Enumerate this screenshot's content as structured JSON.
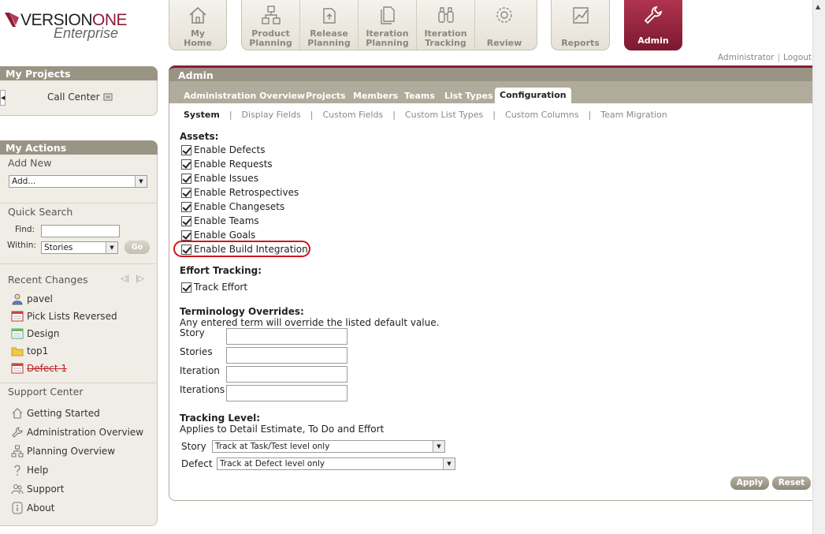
{
  "brand": {
    "word1_a": "VERSION",
    "word1_b": "ONE",
    "word2": "Enterprise"
  },
  "nav_left": [
    {
      "l1": "My",
      "l2": "Home",
      "icon": "home-icon"
    }
  ],
  "nav_mid": [
    {
      "l1": "Product",
      "l2": "Planning",
      "icon": "hierarchy-icon"
    },
    {
      "l1": "Release",
      "l2": "Planning",
      "icon": "release-icon"
    },
    {
      "l1": "Iteration",
      "l2": "Planning",
      "icon": "iteration-icon"
    },
    {
      "l1": "Iteration",
      "l2": "Tracking",
      "icon": "binoculars-icon"
    },
    {
      "l1": "",
      "l2": "Review",
      "icon": "gear-icon"
    }
  ],
  "nav_reports": {
    "label": "Reports",
    "icon": "chart-icon"
  },
  "nav_admin": {
    "label": "Admin",
    "icon": "wrench-icon"
  },
  "user_links": {
    "user": "Administrator",
    "sep": "|",
    "logout": "Logout"
  },
  "my_projects": {
    "title": "My Projects",
    "project": "Call Center"
  },
  "my_actions": {
    "title": "My Actions",
    "add_new": "Add New",
    "add_select": "Add...",
    "quick_search": "Quick Search",
    "find_label": "Find:",
    "within_label": "Within:",
    "within_value": "Stories",
    "go": "Go"
  },
  "recent": {
    "title": "Recent Changes",
    "items": [
      {
        "label": "pavel",
        "icon": "user-icon"
      },
      {
        "label": "Pick Lists Reversed",
        "icon": "defect-icon"
      },
      {
        "label": "Design",
        "icon": "story-icon"
      },
      {
        "label": "top1",
        "icon": "folder-icon"
      },
      {
        "label": "Defect 1",
        "icon": "defect-icon",
        "struck": true
      }
    ]
  },
  "support": {
    "title": "Support Center",
    "items": [
      {
        "label": "Getting Started",
        "icon": "home-icon"
      },
      {
        "label": "Administration Overview",
        "icon": "wrench-icon"
      },
      {
        "label": "Planning Overview",
        "icon": "hierarchy-icon"
      },
      {
        "label": "Help",
        "icon": "question-icon"
      },
      {
        "label": "Support",
        "icon": "people-icon"
      },
      {
        "label": "About",
        "icon": "info-icon"
      }
    ]
  },
  "main": {
    "title": "Admin",
    "tabs": [
      "Administration Overview",
      "Projects",
      "Members",
      "Teams",
      "List Types",
      "Configuration"
    ],
    "active_tab": "Configuration",
    "subtabs": [
      "System",
      "Display Fields",
      "Custom Fields",
      "Custom List Types",
      "Custom Columns",
      "Team Migration"
    ],
    "assets_title": "Assets:",
    "assets": [
      "Enable Defects",
      "Enable Requests",
      "Enable Issues",
      "Enable Retrospectives",
      "Enable Changesets",
      "Enable Teams",
      "Enable Goals",
      "Enable Build Integration"
    ],
    "effort_title": "Effort Tracking:",
    "effort": [
      "Track Effort"
    ],
    "term_title": "Terminology Overrides:",
    "term_desc": "Any entered term will override the listed default value.",
    "terms": [
      "Story",
      "Stories",
      "Iteration",
      "Iterations"
    ],
    "tracking_title": "Tracking Level:",
    "tracking_desc": "Applies to Detail Estimate, To Do and Effort",
    "tracking": [
      {
        "label": "Story",
        "value": "Track at Task/Test level only"
      },
      {
        "label": "Defect",
        "value": "Track at Defect level only"
      }
    ],
    "apply": "Apply",
    "reset": "Reset"
  },
  "colors": {
    "accent": "#8a1c3a",
    "panel": "#9a9484",
    "highlight": "#d0161b"
  }
}
